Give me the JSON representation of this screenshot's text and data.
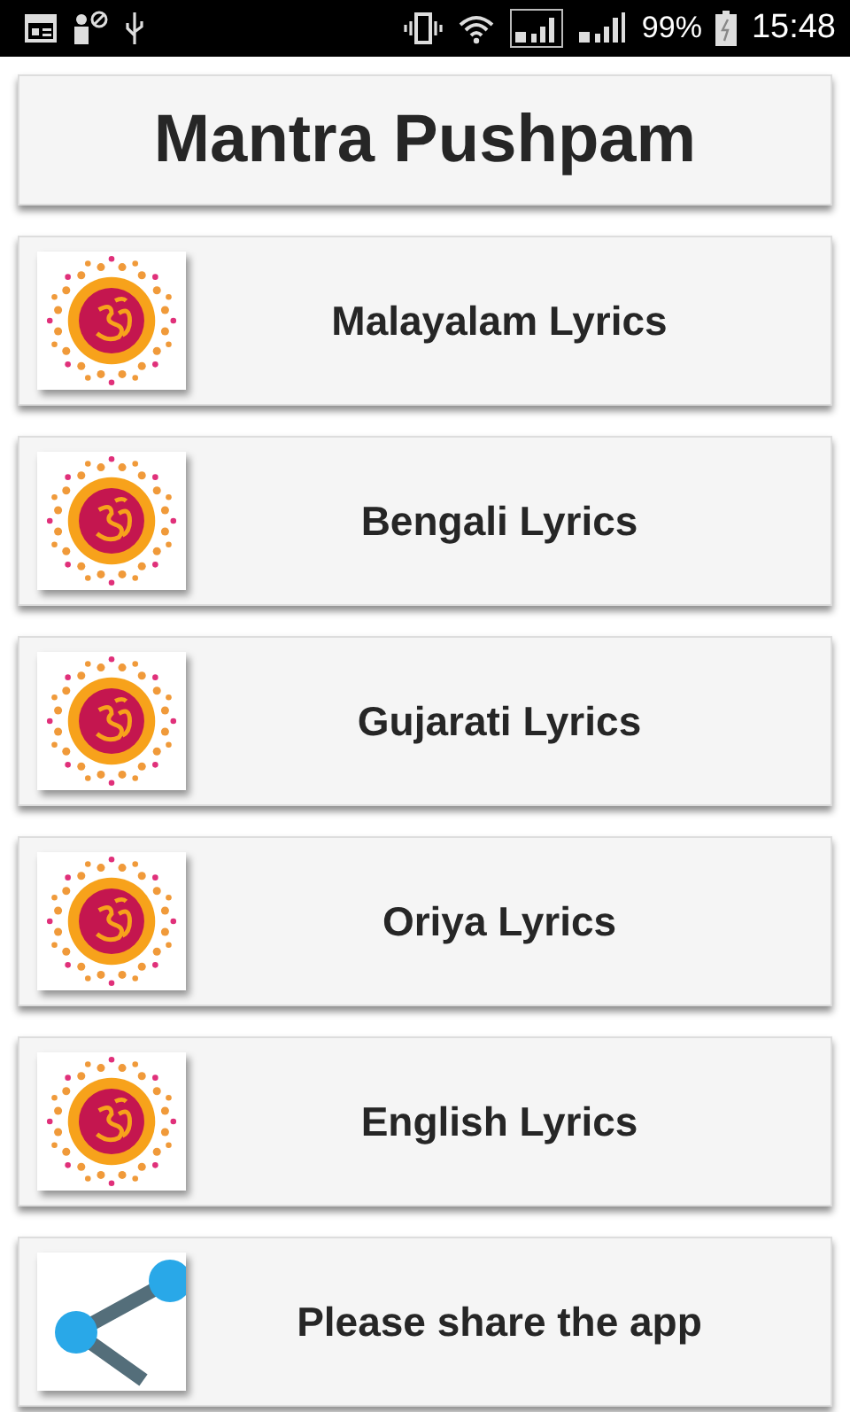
{
  "status_bar": {
    "battery": "99%",
    "time": "15:48"
  },
  "title": "Mantra Pushpam",
  "items": [
    {
      "label": "Malayalam Lyrics",
      "kind": "mandala"
    },
    {
      "label": "Bengali Lyrics",
      "kind": "mandala"
    },
    {
      "label": "Gujarati Lyrics",
      "kind": "mandala"
    },
    {
      "label": "Oriya Lyrics",
      "kind": "mandala"
    },
    {
      "label": "English Lyrics",
      "kind": "mandala"
    },
    {
      "label": "Please share the app",
      "kind": "share"
    }
  ]
}
